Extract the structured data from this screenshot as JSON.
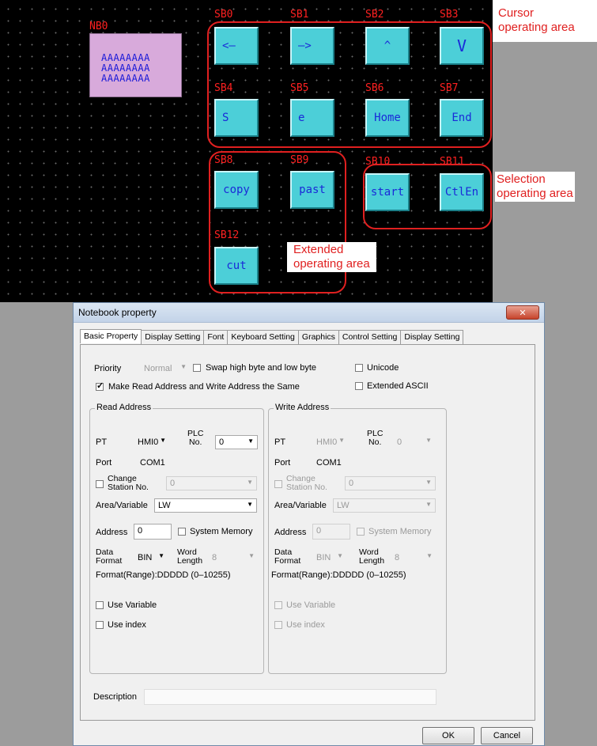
{
  "canvas": {
    "notebook": {
      "id": "NB0",
      "lines": [
        "AAAAAAAA",
        "AAAAAAAA",
        "AAAAAAAA"
      ]
    },
    "buttons": [
      {
        "id": "SB0",
        "text": "<—"
      },
      {
        "id": "SB1",
        "text": "—>"
      },
      {
        "id": "SB2",
        "text": "^"
      },
      {
        "id": "SB3",
        "text": "V"
      },
      {
        "id": "SB4",
        "text": "S"
      },
      {
        "id": "SB5",
        "text": "e"
      },
      {
        "id": "SB6",
        "text": "Home"
      },
      {
        "id": "SB7",
        "text": "End"
      },
      {
        "id": "SB8",
        "text": "copy"
      },
      {
        "id": "SB9",
        "text": "past"
      },
      {
        "id": "SB10",
        "text": "start"
      },
      {
        "id": "SB11",
        "text": "CtlEn"
      },
      {
        "id": "SB12",
        "text": "cut"
      }
    ],
    "callouts": {
      "cursor": [
        "Cursor",
        "operating area"
      ],
      "selection": [
        "Selection",
        "operating area"
      ],
      "extended": [
        "Extended",
        "operating area"
      ]
    },
    "annotation_color": "#e02020",
    "button_color": "#4ccfd8"
  },
  "dialog": {
    "title": "Notebook property",
    "close_label": "✕",
    "tabs": [
      "Basic Property",
      "Display Setting",
      "Font",
      "Keyboard Setting",
      "Graphics",
      "Control Setting",
      "Display Setting"
    ],
    "priority": {
      "label": "Priority",
      "value": "Normal"
    },
    "swap_bytes": {
      "label": "Swap high byte and low byte",
      "checked": false
    },
    "unicode": {
      "label": "Unicode",
      "checked": false
    },
    "same_address": {
      "label": "Make Read Address and Write Address the Same",
      "checked": true
    },
    "extended_ascii": {
      "label": "Extended ASCII",
      "checked": false
    },
    "read": {
      "title": "Read Address",
      "pt_label": "PT",
      "pt_value": "HMI0",
      "plc_label_1": "PLC",
      "plc_label_2": "No.",
      "plc_value": "0",
      "port_label": "Port",
      "port_value": "COM1",
      "change_station_1": "Change",
      "change_station_2": "Station No.",
      "station_value": "0",
      "area_label": "Area/Variable",
      "area_value": "LW",
      "address_label": "Address",
      "address_value": "0",
      "system_memory": "System Memory",
      "data_format_1": "Data",
      "data_format_2": "Format",
      "data_format_value": "BIN",
      "word_length_1": "Word",
      "word_length_2": "Length",
      "word_length_value": "8",
      "format_range": "Format(Range):DDDDD (0–10255)",
      "use_variable": "Use Variable",
      "use_index": "Use index"
    },
    "write": {
      "title": "Write Address",
      "pt_label": "PT",
      "pt_value": "HMI0",
      "plc_label_1": "PLC",
      "plc_label_2": "No.",
      "plc_value": "0",
      "port_label": "Port",
      "port_value": "COM1",
      "change_station_1": "Change",
      "change_station_2": "Station No.",
      "station_value": "0",
      "area_label": "Area/Variable",
      "area_value": "LW",
      "address_label": "Address",
      "address_value": "0",
      "system_memory": "System Memory",
      "data_format_1": "Data",
      "data_format_2": "Format",
      "data_format_value": "BIN",
      "word_length_1": "Word",
      "word_length_2": "Length",
      "word_length_value": "8",
      "format_range": "Format(Range):DDDDD (0–10255)",
      "use_variable": "Use Variable",
      "use_index": "Use index"
    },
    "description_label": "Description",
    "description_value": "",
    "ok_label": "OK",
    "cancel_label": "Cancel"
  }
}
